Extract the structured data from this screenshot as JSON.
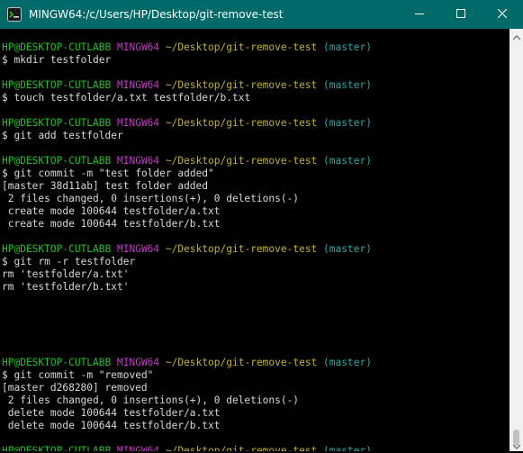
{
  "window": {
    "title": "MINGW64:/c/Users/HP/Desktop/git-remove-test",
    "accent_color": "#006a68",
    "icons": {
      "app": "mingw-terminal-icon",
      "minimize": "minimize-icon",
      "maximize": "maximize-icon",
      "close": "close-icon"
    }
  },
  "prompt": {
    "user_host": "HP@DESKTOP-CUTLABB",
    "system": "MINGW64",
    "path": "~/Desktop/git-remove-test",
    "branch": "(master)",
    "symbol": "$"
  },
  "colors": {
    "user_host": "#1ec41e",
    "system": "#c23cc2",
    "path": "#c0b12b",
    "branch": "#2aa7a7",
    "output": "#d8d8d8"
  },
  "terminal_lines": [
    {
      "type": "blank"
    },
    {
      "type": "prompt"
    },
    {
      "type": "command",
      "text": "mkdir testfolder"
    },
    {
      "type": "blank"
    },
    {
      "type": "prompt"
    },
    {
      "type": "command",
      "text": "touch testfolder/a.txt testfolder/b.txt"
    },
    {
      "type": "blank"
    },
    {
      "type": "prompt"
    },
    {
      "type": "command",
      "text": "git add testfolder"
    },
    {
      "type": "blank"
    },
    {
      "type": "prompt"
    },
    {
      "type": "command",
      "text": "git commit -m \"test folder added\""
    },
    {
      "type": "output",
      "text": "[master 38d11ab] test folder added"
    },
    {
      "type": "output",
      "text": " 2 files changed, 0 insertions(+), 0 deletions(-)"
    },
    {
      "type": "output",
      "text": " create mode 100644 testfolder/a.txt"
    },
    {
      "type": "output",
      "text": " create mode 100644 testfolder/b.txt"
    },
    {
      "type": "blank"
    },
    {
      "type": "prompt"
    },
    {
      "type": "command",
      "text": "git rm -r testfolder"
    },
    {
      "type": "output",
      "text": "rm 'testfolder/a.txt'"
    },
    {
      "type": "output",
      "text": "rm 'testfolder/b.txt'"
    },
    {
      "type": "blank"
    },
    {
      "type": "blank"
    },
    {
      "type": "blank"
    },
    {
      "type": "blank"
    },
    {
      "type": "blank"
    },
    {
      "type": "prompt"
    },
    {
      "type": "command",
      "text": "git commit -m \"removed\""
    },
    {
      "type": "output",
      "text": "[master d268280] removed"
    },
    {
      "type": "output",
      "text": " 2 files changed, 0 insertions(+), 0 deletions(-)"
    },
    {
      "type": "output",
      "text": " delete mode 100644 testfolder/a.txt"
    },
    {
      "type": "output",
      "text": " delete mode 100644 testfolder/b.txt"
    },
    {
      "type": "blank"
    },
    {
      "type": "prompt"
    }
  ]
}
